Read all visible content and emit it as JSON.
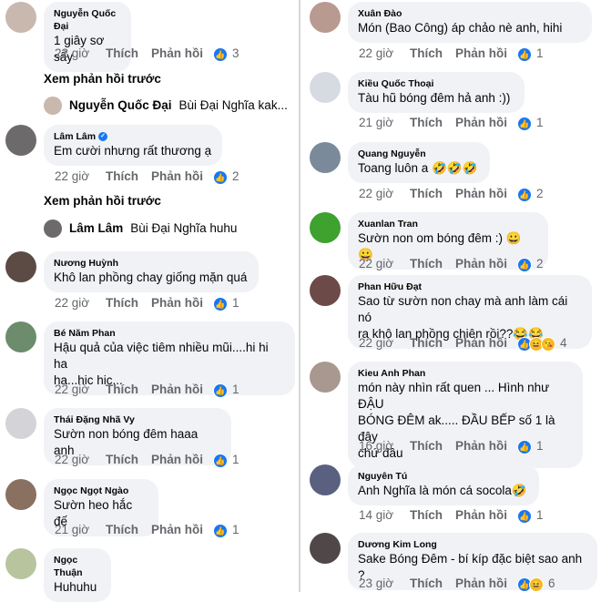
{
  "left": {
    "comments": [
      {
        "name": "Nguyễn Quốc Đại",
        "text": "1 giây sơ sẩy",
        "time": "22 giờ",
        "like": "Thích",
        "reply": "Phản hồi",
        "reactions": "like",
        "count": "3",
        "avatar": "#c8b8ae"
      },
      {
        "name": "Lâm Lâm",
        "text": "Em cười nhưng rất thương ạ",
        "time": "22 giờ",
        "like": "Thích",
        "reply": "Phản hồi",
        "reactions": "like",
        "count": "2",
        "avatar": "#6c6a6a",
        "verified": true
      },
      {
        "name": "Nương Huỳnh",
        "text": "Khô lan phồng chay giống mặn quá",
        "time": "22 giờ",
        "like": "Thích",
        "reply": "Phản hồi",
        "reactions": "like",
        "count": "1",
        "avatar": "#5b4b44"
      },
      {
        "name": "Bé Năm Phan",
        "text": "Hậu quả của việc tiêm nhiều mũi....hi hi ha\nha...hic hic...",
        "time": "22 giờ",
        "like": "Thích",
        "reply": "Phản hồi",
        "reactions": "like",
        "count": "1",
        "avatar": "#6c8c6c"
      },
      {
        "name": "Thái Đặng Nhã Vy",
        "text": "Sườn non bóng đêm haaa anh",
        "time": "22 giờ",
        "like": "Thích",
        "reply": "Phản hồi",
        "reactions": "like",
        "count": "1",
        "avatar": "#d3d3d8"
      },
      {
        "name": "Ngọc Ngọt Ngào",
        "text": "Sườn heo hắc đế",
        "time": "21 giờ",
        "like": "Thích",
        "reply": "Phản hồi",
        "reactions": "like",
        "count": "1",
        "avatar": "#8a7060"
      },
      {
        "name": "Ngọc Thuận",
        "text": "Huhuhu",
        "avatar": "#b8c49e"
      }
    ],
    "prev_replies": [
      {
        "label": "Xem phản hồi trước",
        "name": "Nguyễn Quốc Đại",
        "text": "Bùi Đại Nghĩa  kak...",
        "avatar": "#c8b8ae"
      },
      {
        "label": "Xem phản hồi trước",
        "name": "Lâm Lâm",
        "text": "Bùi Đại Nghĩa  huhu",
        "avatar": "#6c6a6a"
      }
    ]
  },
  "right": {
    "comments": [
      {
        "name": "Xuân Đào",
        "text": "Món (Bao Công) áp chảo nè anh, hihi",
        "time": "22 giờ",
        "like": "Thích",
        "reply": "Phản hồi",
        "reactions": "like",
        "count": "1",
        "avatar": "#b99a90"
      },
      {
        "name": "Kiều Quốc Thoại",
        "text": "Tàu hũ bóng đêm hả anh :))",
        "time": "21 giờ",
        "like": "Thích",
        "reply": "Phản hồi",
        "reactions": "like",
        "count": "1",
        "avatar": "#d6dbe2"
      },
      {
        "name": "Quang Nguyễn",
        "text": "Toang luôn a 🤣🤣🤣",
        "time": "22 giờ",
        "like": "Thích",
        "reply": "Phản hồi",
        "reactions": "like",
        "count": "2",
        "avatar": "#7a8a9a"
      },
      {
        "name": "Xuanlan Tran",
        "text": "Sườn non om bóng đêm :) 😀 😀",
        "time": "22 giờ",
        "like": "Thích",
        "reply": "Phản hồi",
        "reactions": "like",
        "count": "2",
        "avatar": "#3fa12e"
      },
      {
        "name": "Phan Hữu Đạt",
        "text": "Sao từ sườn non chay mà anh làm cái nó\nra khô lan phồng chiên rồi??😂😂",
        "time": "22 giờ",
        "like": "Thích",
        "reply": "Phản hồi",
        "reactions": "multi",
        "count": "4",
        "avatar": "#6b4a48"
      },
      {
        "name": "Kieu Anh Phan",
        "text": "món này nhìn rất quen ... Hình như ĐẬU\nBÓNG ĐÊM ak..... ĐẦU BẾP số 1 là đây\nchứ đâu",
        "time": "16 giờ",
        "like": "Thích",
        "reply": "Phản hồi",
        "reactions": "like",
        "count": "1",
        "avatar": "#a89890"
      },
      {
        "name": "Nguyên Tú",
        "text": "Anh Nghĩa là món cá socola🤣",
        "time": "14 giờ",
        "like": "Thích",
        "reply": "Phản hồi",
        "reactions": "like",
        "count": "1",
        "avatar": "#5a6080"
      },
      {
        "name": "Dương Kim Long",
        "text": "Sake Bóng Đêm - bí kíp đặc biệt sao anh ?",
        "time": "23 giờ",
        "like": "Thích",
        "reply": "Phản hồi",
        "reactions": "haha",
        "count": "6",
        "avatar": "#504848"
      }
    ]
  }
}
